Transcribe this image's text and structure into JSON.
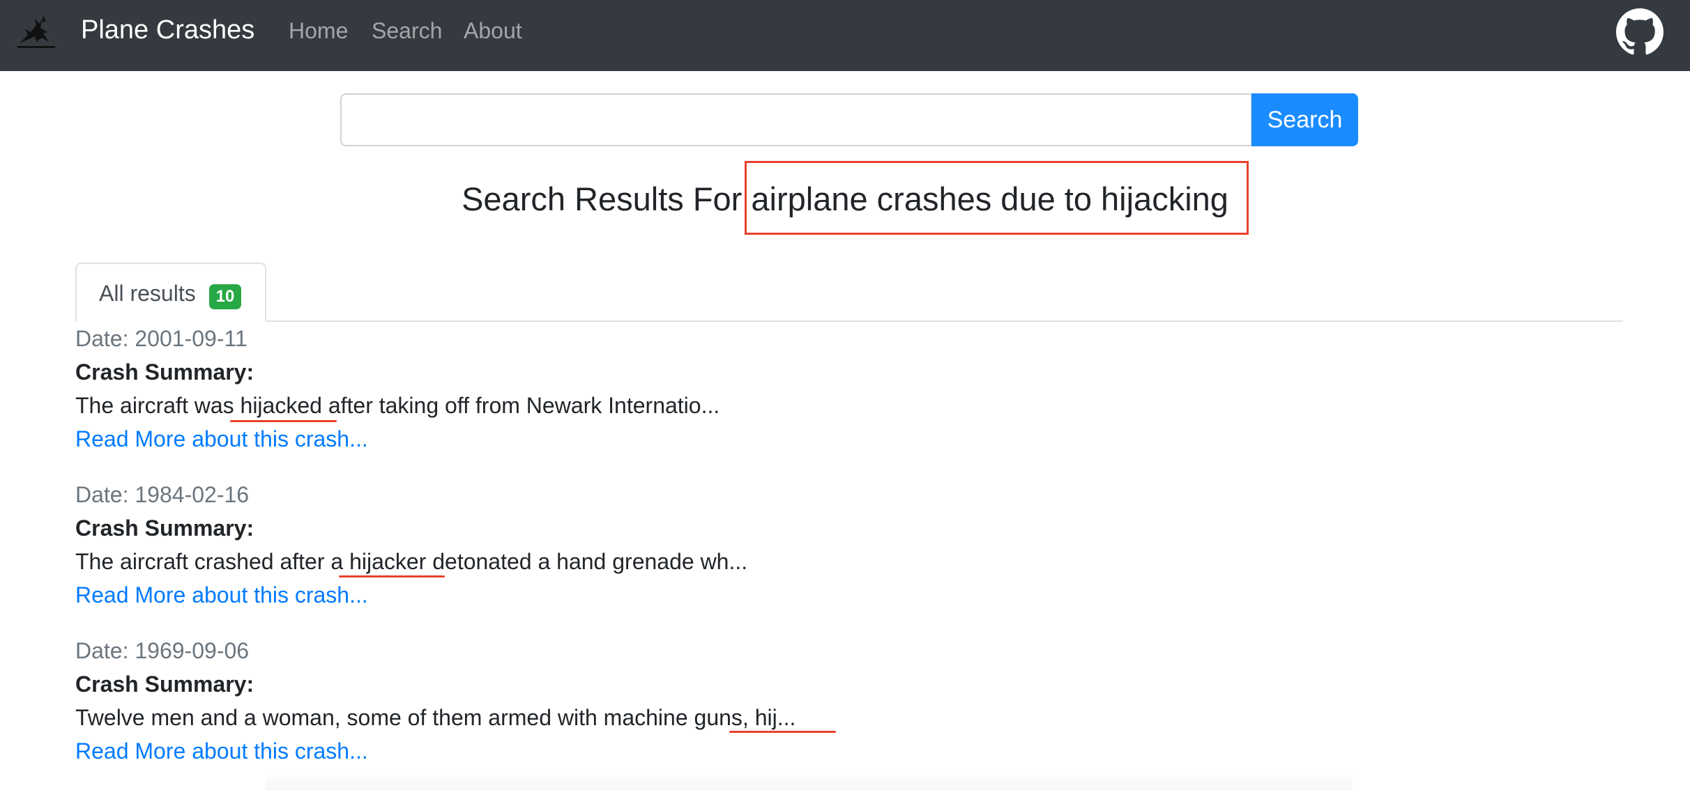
{
  "navbar": {
    "brand": "Plane Crashes",
    "links": [
      "Home",
      "Search",
      "About"
    ]
  },
  "search": {
    "value": "",
    "button_label": "Search"
  },
  "results_heading": {
    "prefix": "Search Results For",
    "query": "airplane crashes due to hijacking"
  },
  "tabs": [
    {
      "label": "All results",
      "count": "10"
    }
  ],
  "results": [
    {
      "date": "Date: 2001-09-11",
      "summary_label": "Crash Summary:",
      "summary": "The aircraft was hijacked after taking off from Newark Internatio...",
      "link": "Read More about this crash..."
    },
    {
      "date": "Date: 1984-02-16",
      "summary_label": "Crash Summary:",
      "summary": "The aircraft crashed after a hijacker detonated a hand grenade wh...",
      "link": "Read More about this crash..."
    },
    {
      "date": "Date: 1969-09-06",
      "summary_label": "Crash Summary:",
      "summary": "Twelve men and a woman, some of them armed with machine guns, hij...",
      "link": "Read More about this crash..."
    }
  ],
  "colors": {
    "navbar_bg": "#343a40",
    "primary": "#1a8cff",
    "link": "#007bff",
    "badge": "#28a745",
    "annotation": "#e8412f"
  },
  "icons": [
    "plane-crash-logo-icon",
    "github-icon"
  ]
}
